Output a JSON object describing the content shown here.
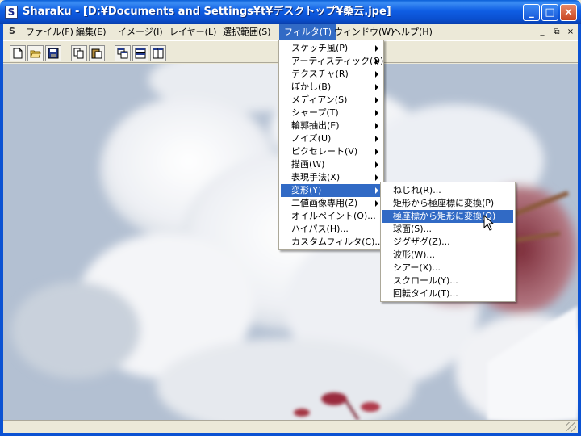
{
  "window": {
    "title": "Sharaku - [D:¥Documents and Settings¥t¥デスクトップ¥桑云.jpe]",
    "app_icon_glyph": "S",
    "controls": [
      "minimize",
      "maximize",
      "close"
    ]
  },
  "menubar": {
    "items": [
      {
        "label": "ファイル(F)"
      },
      {
        "label": "編集(E)"
      },
      {
        "label": "イメージ(I)"
      },
      {
        "label": "レイヤー(L)"
      },
      {
        "label": "選択範囲(S)"
      },
      {
        "label": "フィルタ(T)",
        "active": true
      },
      {
        "label": "ウィンドウ(W)"
      },
      {
        "label": "ヘルプ(H)"
      }
    ],
    "mdi_controls": [
      "_",
      "⧉",
      "×"
    ]
  },
  "toolbar": {
    "buttons": [
      "new-file-icon",
      "open-folder-icon",
      "save-disk-icon",
      "copy-icon",
      "paste-icon",
      "cascade-windows-icon",
      "tile-horizontal-icon",
      "tile-vertical-icon"
    ]
  },
  "filter_menu": {
    "items": [
      {
        "label": "スケッチ風(P)",
        "submenu": true
      },
      {
        "label": "アーティスティック(Q)",
        "submenu": true
      },
      {
        "label": "テクスチャ(R)",
        "submenu": true
      },
      {
        "label": "ぼかし(B)",
        "submenu": true
      },
      {
        "label": "メディアン(S)",
        "submenu": true
      },
      {
        "label": "シャープ(T)",
        "submenu": true
      },
      {
        "label": "輪郭抽出(E)",
        "submenu": true
      },
      {
        "label": "ノイズ(U)",
        "submenu": true
      },
      {
        "label": "ピクセレート(V)",
        "submenu": true
      },
      {
        "label": "描画(W)",
        "submenu": true
      },
      {
        "label": "表現手法(X)",
        "submenu": true
      },
      {
        "label": "変形(Y)",
        "submenu": true,
        "highlighted": true
      },
      {
        "label": "二値画像専用(Z)",
        "submenu": true
      },
      {
        "label": "オイルペイント(O)...",
        "submenu": false
      },
      {
        "label": "ハイパス(H)...",
        "submenu": false
      },
      {
        "label": "カスタムフィルタ(C)...",
        "submenu": false
      }
    ]
  },
  "transform_submenu": {
    "items": [
      {
        "label": "ねじれ(R)..."
      },
      {
        "label": "矩形から極座標に変換(P)"
      },
      {
        "label": "極座標から矩形に変換(Q)",
        "highlighted": true
      },
      {
        "label": "球面(S)..."
      },
      {
        "label": "ジグザグ(Z)..."
      },
      {
        "label": "波形(W)..."
      },
      {
        "label": "シアー(X)..."
      },
      {
        "label": "スクロール(Y)..."
      },
      {
        "label": "回転タイル(T)..."
      }
    ]
  },
  "colors": {
    "titlebar": "#0a58d8",
    "menu_highlight": "#316ac5",
    "chrome": "#ece9d8"
  }
}
